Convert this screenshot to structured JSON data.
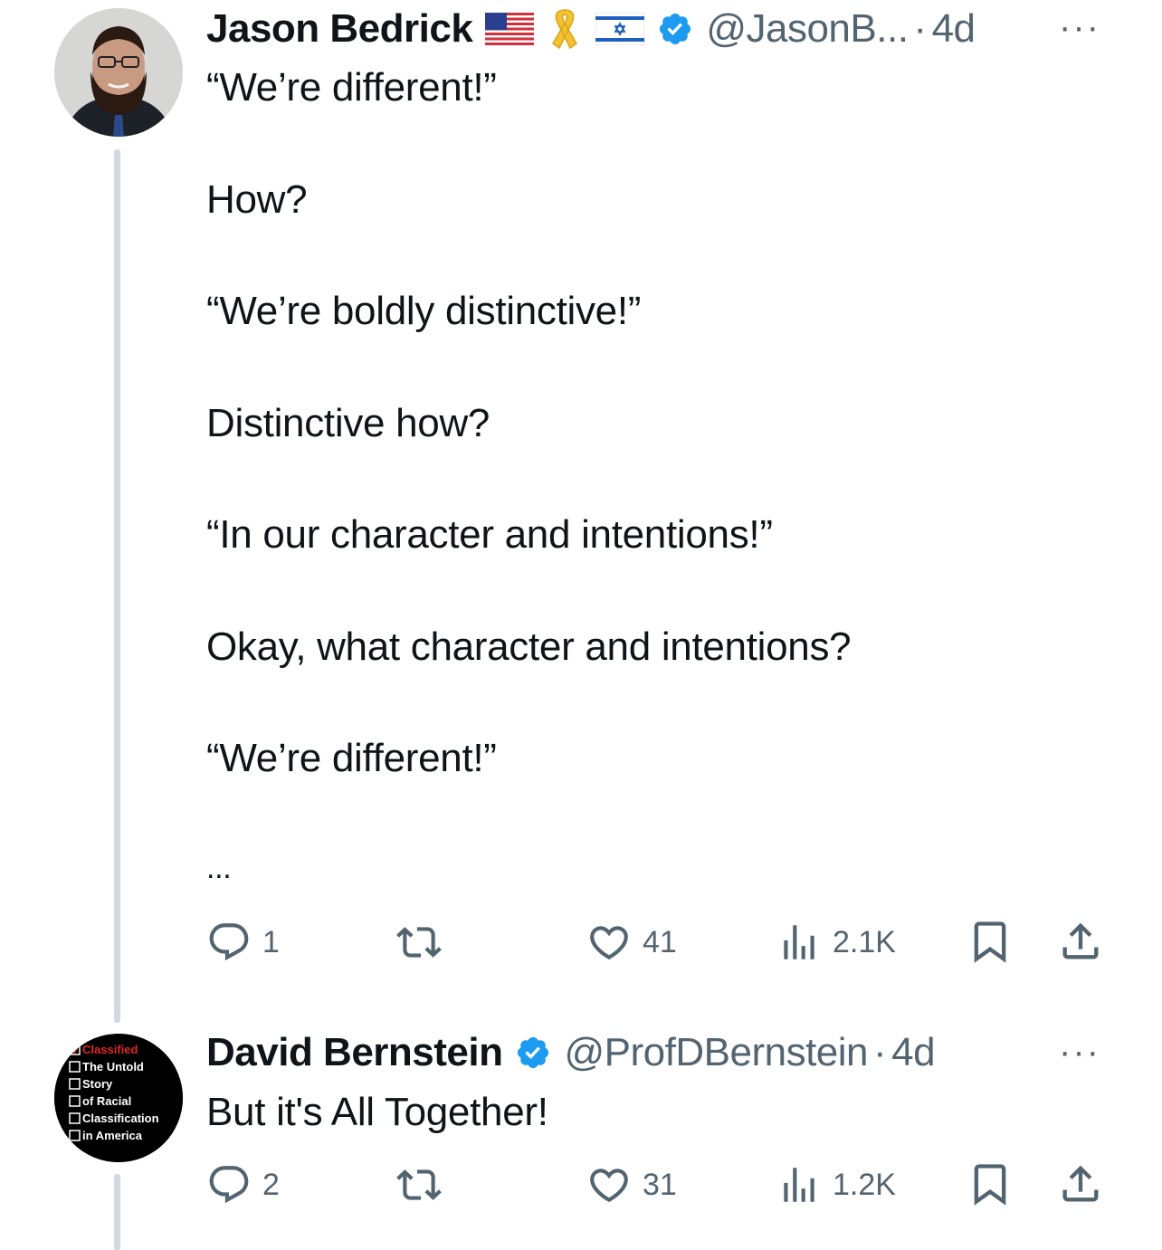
{
  "tweets": [
    {
      "author": {
        "name": "Jason Bedrick",
        "handle": "@JasonB...",
        "time": "4d",
        "dot": "·",
        "avatar_icon": "person-photo-avatar",
        "badges": [
          "us-flag-icon",
          "yellow-ribbon-icon",
          "israel-flag-icon",
          "verified-badge-icon"
        ]
      },
      "lines": [
        "“We’re different!”",
        "How?",
        "“We’re boldly distinctive!”",
        "Distinctive how?",
        "“In our character and intentions!”",
        "Okay, what character and intentions?",
        "“We’re different!”",
        "..."
      ],
      "actions": {
        "replies": "1",
        "reposts": "",
        "likes": "41",
        "views": "2.1K"
      }
    },
    {
      "author": {
        "name": "David Bernstein",
        "handle": "@ProfDBernstein",
        "time": "4d",
        "dot": "·",
        "avatar_icon": "book-cover-avatar",
        "avatar_text": [
          "Classified",
          "The Untold",
          "Story",
          "of Racial",
          "Classification",
          "in America"
        ],
        "badges": [
          "verified-badge-icon"
        ]
      },
      "lines": [
        "But it's All Together!"
      ],
      "actions": {
        "replies": "2",
        "reposts": "",
        "likes": "31",
        "views": "1.2K"
      }
    }
  ],
  "more_label": "···",
  "colors": {
    "text": "#0f1419",
    "muted": "#536471",
    "verified": "#1d9bf0",
    "thread": "#cfd9de",
    "avatar_red": "#e0262b"
  }
}
